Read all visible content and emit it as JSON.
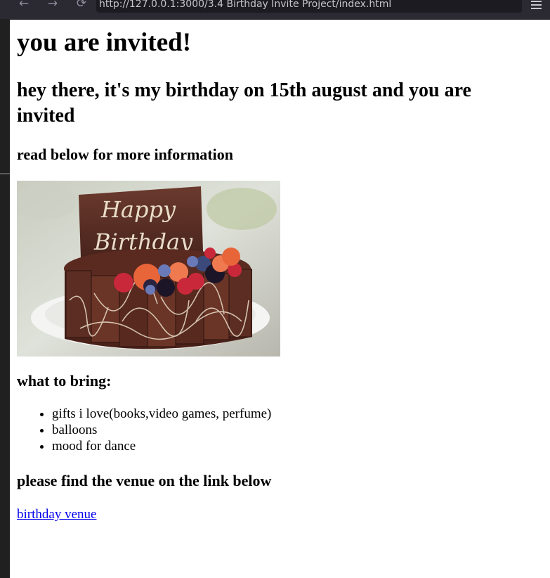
{
  "browser": {
    "url": "http://127.0.0.1:3000/3.4 Birthday Invite Project/index.html",
    "back_icon": "arrow-left",
    "forward_icon": "arrow-right",
    "reload_icon": "reload",
    "menu_icon": "hamburger-menu"
  },
  "page": {
    "title": "you are invited!",
    "subtitle": "hey there, it's my birthday on 15th august and you are invited",
    "info_heading": "read below for more information",
    "image": {
      "description_icon": "birthday-cake-image",
      "cake_text": [
        "Happy",
        "Birthday"
      ]
    },
    "bring_heading": "what to bring:",
    "bring_items": [
      "gifts i love(books,video games, perfume)",
      "balloons",
      "mood for dance"
    ],
    "venue_heading": "please find the venue on the link below",
    "venue_link": "birthday venue"
  },
  "colors": {
    "chrome_bg": "#2b2a33",
    "url_bg": "#1c1b22",
    "link": "#0000ee",
    "page_bg": "#ffffff"
  }
}
